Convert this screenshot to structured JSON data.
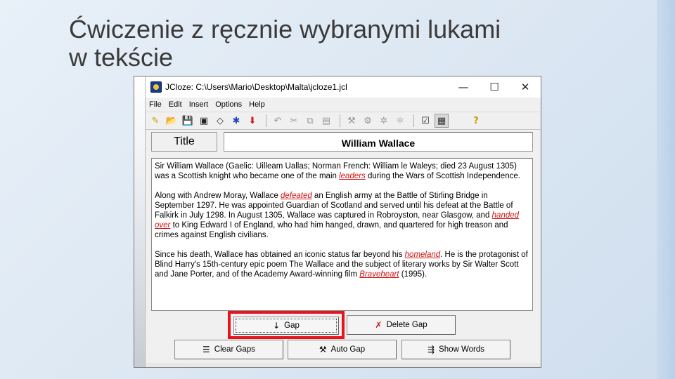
{
  "slide": {
    "title_line1": "Ćwiczenie z ręcznie wybranymi lukami",
    "title_line2": "w tekście"
  },
  "window": {
    "title": "JCloze: C:\\Users\\Mario\\Desktop\\Malta\\jcloze1.jcl",
    "minimize": "—",
    "maximize": "☐",
    "close": "✕"
  },
  "menu": [
    "File",
    "Edit",
    "Insert",
    "Options",
    "Help"
  ],
  "toolbar_icons": [
    "new-icon",
    "open-icon",
    "save-icon",
    "save-as-icon",
    "export-icon",
    "tool-icon",
    "arrow-down-icon",
    "undo-icon",
    "cut-icon",
    "copy-icon",
    "paste-icon",
    "gap-tool-icon",
    "gap-tool2-icon",
    "gap-tool3-icon",
    "gap-tool4-icon",
    "checkbox-icon",
    "config-icon",
    "help-icon"
  ],
  "title_label": "Title",
  "title_value": "William Wallace",
  "text": {
    "p1": [
      {
        "t": "Sir William Wallace (Gaelic: Uilleam Uallas; Norman French: William le Waleys; died 23 August 1305) was a Scottish knight who became one of the main "
      },
      {
        "t": "leaders",
        "gap": true
      },
      {
        "t": " during the Wars of Scottish Independence."
      }
    ],
    "p2": [
      {
        "t": "Along with Andrew Moray, Wallace "
      },
      {
        "t": "defeated",
        "gap": true
      },
      {
        "t": " an English army at the Battle of Stirling Bridge in September 1297. He was appointed Guardian of Scotland and served until his defeat at the Battle of Falkirk in July 1298. In August 1305, Wallace was captured in Robroyston, near Glasgow, and "
      },
      {
        "t": "handed over",
        "gap": true
      },
      {
        "t": " to King Edward I of England, who had him hanged, drawn, and quartered for high treason and crimes against English civilians."
      }
    ],
    "p3": [
      {
        "t": "Since his death, Wallace has obtained an iconic status far beyond his "
      },
      {
        "t": "homeland",
        "gap": true
      },
      {
        "t": ". He is the protagonist of Blind Harry's 15th-century epic poem The Wallace and the subject of literary works by Sir Walter Scott and Jane Porter, and of the Academy Award-winning film "
      },
      {
        "t": "Braveheart",
        "gap": true
      },
      {
        "t": " (1995)."
      }
    ]
  },
  "buttons": {
    "gap": "Gap",
    "delete_gap": "Delete Gap",
    "clear_gaps": "Clear Gaps",
    "auto_gap": "Auto Gap",
    "show_words": "Show Words"
  },
  "colors": {
    "highlight": "#e8141c",
    "gap_word": "#d01010"
  }
}
